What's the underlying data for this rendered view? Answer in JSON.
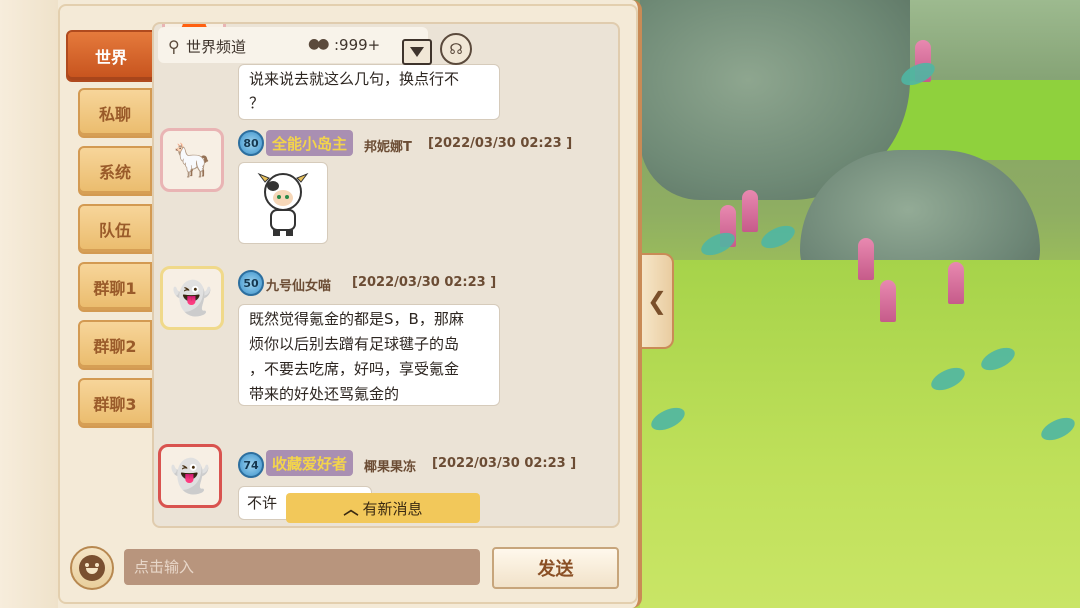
{
  "tabs": [
    {
      "label": "世界",
      "active": true
    },
    {
      "label": "私聊"
    },
    {
      "label": "系统"
    },
    {
      "label": "队伍"
    },
    {
      "label": "群聊1"
    },
    {
      "label": "群聊2"
    },
    {
      "label": "群聊3"
    }
  ],
  "channel": {
    "name": "世界频道",
    "online_count": ":999+"
  },
  "messages": [
    {
      "text": "说来说去就这么几句，换点行不？",
      "line1": "说来说去就这么几句，换点行不",
      "line2": "？"
    },
    {
      "level": "80",
      "title": "全能小岛主",
      "user": "邦妮娜T",
      "time": "[2022/03/30 02:23 ]",
      "sticker": "cow-costume-sticker"
    },
    {
      "level": "50",
      "user": "九号仙女喵",
      "time": "[2022/03/30 02:23 ]",
      "lines": [
        "既然觉得氪金的都是S，B，那麻",
        "烦你以后别去蹭有足球毽子的岛",
        "，不要去吃席，好吗，享受氪金",
        "带来的好处还骂氪金的"
      ]
    },
    {
      "level": "74",
      "title": "收藏爱好者",
      "user": "椰果果冻",
      "time": "[2022/03/30 02:23 ]",
      "text_partial": "不许"
    }
  ],
  "new_messages_label": "有新消息",
  "input": {
    "placeholder": "点击输入"
  },
  "send_label": "发送",
  "colors": {
    "active_tab": "#c6521d",
    "tab": "#eabb6c",
    "badge": "#a98fb2",
    "new_msg": "#f2c85a"
  }
}
